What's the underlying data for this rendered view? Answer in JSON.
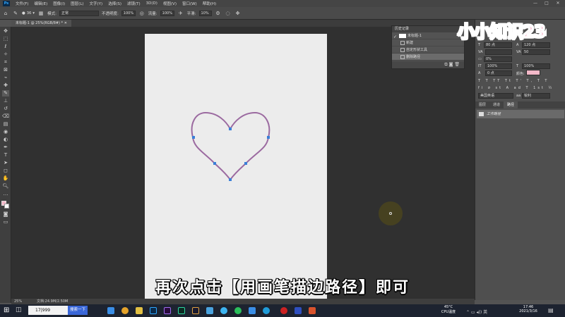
{
  "app": {
    "logo_text": "Ps",
    "menu": [
      "文件(F)",
      "编辑(E)",
      "图像(I)",
      "图层(L)",
      "文字(Y)",
      "选择(S)",
      "滤镜(T)",
      "3D(D)",
      "视图(V)",
      "窗口(W)",
      "帮助(H)"
    ],
    "window_controls": [
      "—",
      "□",
      "✕"
    ]
  },
  "options_bar": {
    "brush_size": "36",
    "mode_label": "模式:",
    "mode_value": "正常",
    "opacity_label": "不透明度:",
    "opacity_value": "100%",
    "flow_label": "流量:",
    "flow_value": "100%",
    "smooth_label": "平滑:",
    "smooth_value": "10%"
  },
  "document": {
    "tab_title": "未标题-1 @ 25%(RGB/8#) *",
    "zoom": "25%",
    "doc_info": "文档:24.9M/2.50M",
    "canvas_color": "#ececec",
    "path_color": "#9b6aa0",
    "anchor_color": "#3a7fd8"
  },
  "history": {
    "title": "历史记录",
    "snapshot": "未标题-1",
    "items": [
      "新建",
      "自定形状工具",
      "删除路径"
    ],
    "selected_index": 2
  },
  "properties": {
    "font_size": "80 点",
    "leading": "120 点",
    "tracking": "50",
    "percent": "0%",
    "vscale": "100%",
    "hscale": "100%",
    "baseline": "0 点",
    "color_label": "颜色:",
    "color_value": "#f3b8c8",
    "language": "美国英语",
    "aa_label": "aa",
    "aa_value": "锐利"
  },
  "paths_panel": {
    "tabs": [
      "图层",
      "通道",
      "路径"
    ],
    "active_tab": 2,
    "work_path": "工作路径"
  },
  "subtitle": "再次点击【用画笔描边路径】即可",
  "watermark": "小小知识234",
  "taskbar": {
    "search_text": "17|999",
    "search_button": "搜索一下",
    "temperature": "45°C",
    "cpu_label": "CPU温度",
    "time": "17:46",
    "date": "2021/3/16"
  }
}
